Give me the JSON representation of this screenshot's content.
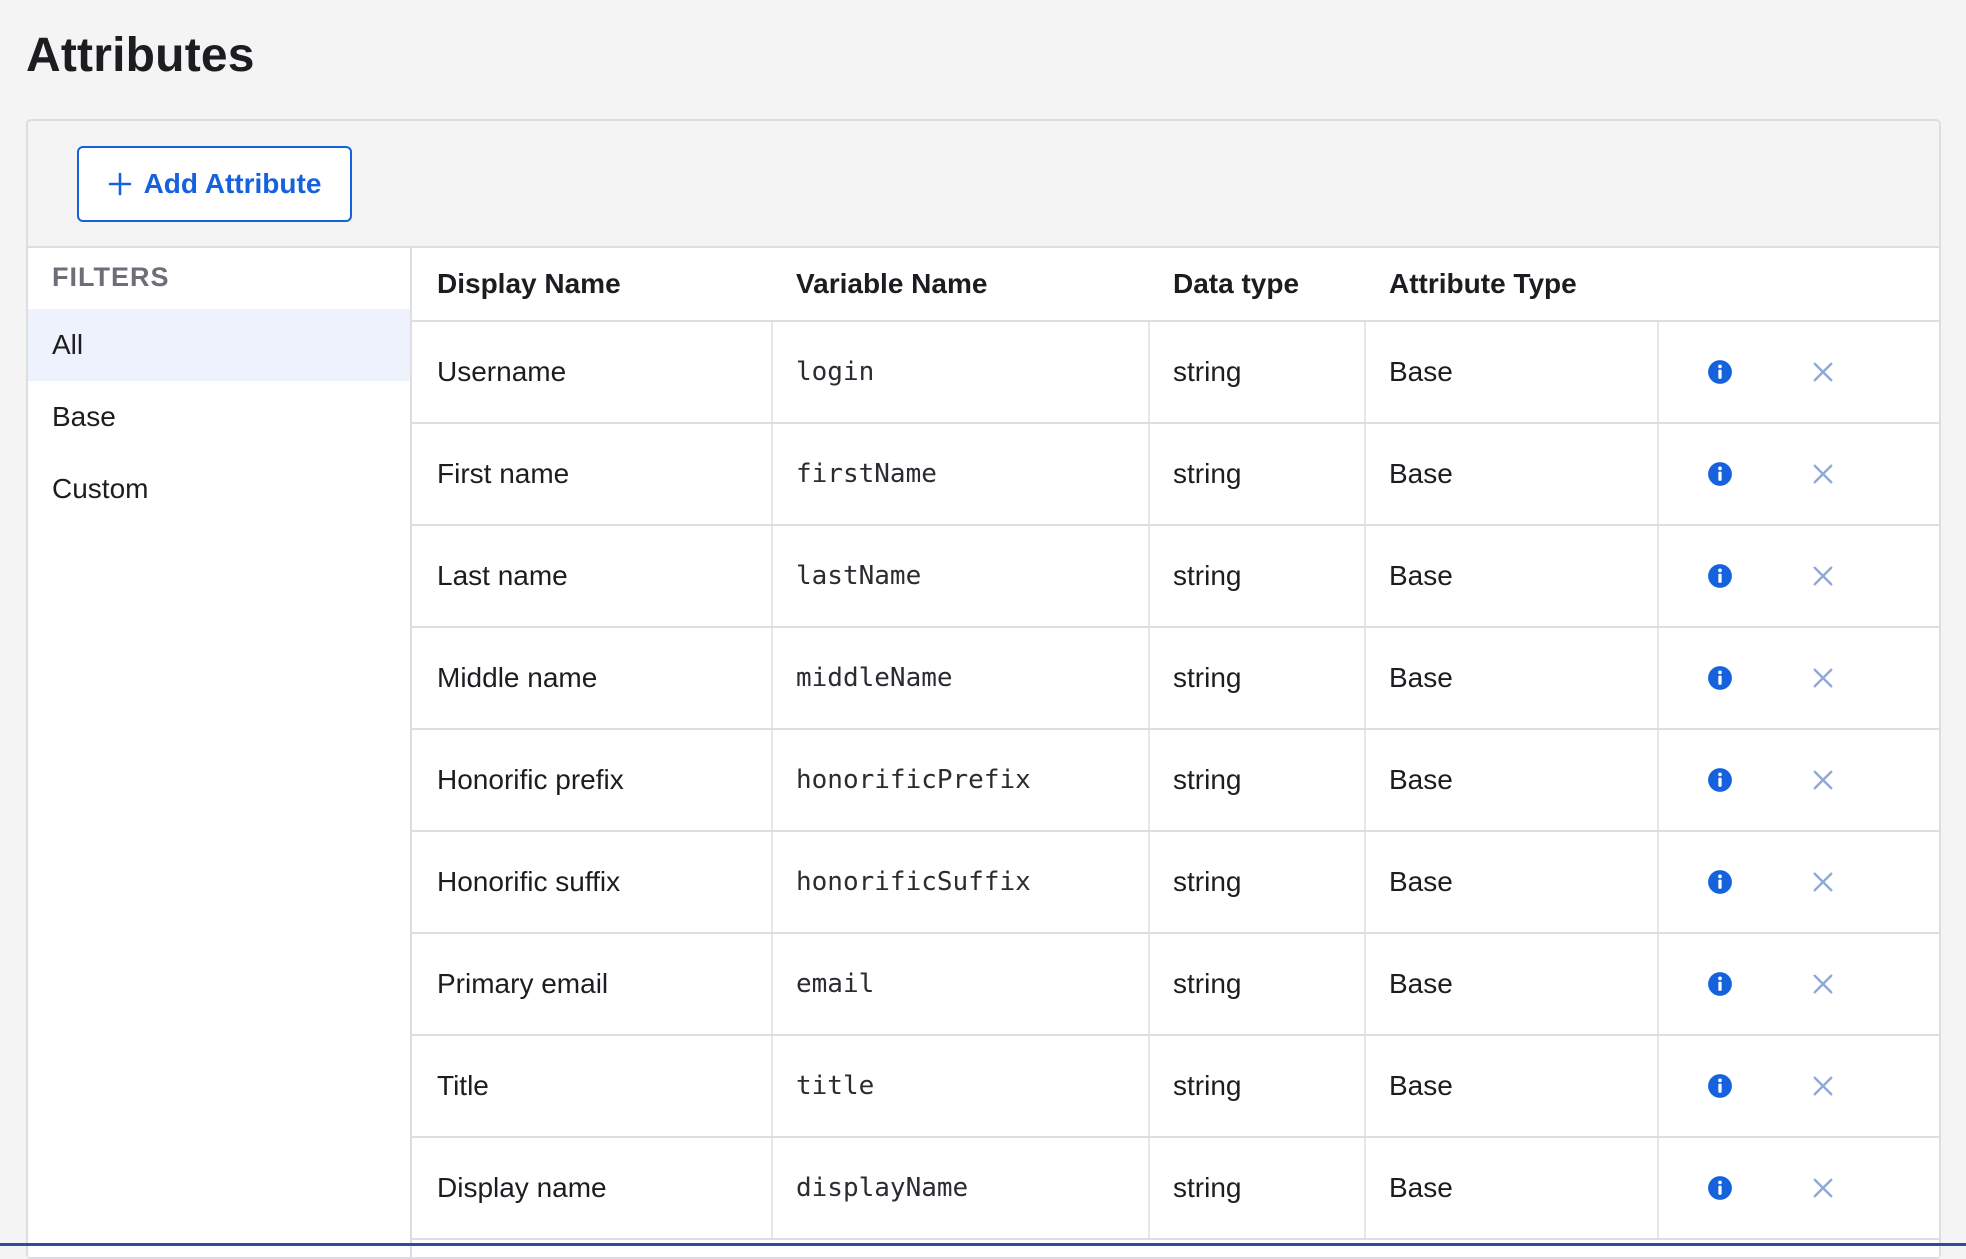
{
  "page": {
    "title": "Attributes"
  },
  "toolbar": {
    "add_label": "Add Attribute"
  },
  "filters": {
    "heading": "FILTERS",
    "items": [
      {
        "label": "All",
        "active": true
      },
      {
        "label": "Base",
        "active": false
      },
      {
        "label": "Custom",
        "active": false
      }
    ]
  },
  "table": {
    "headers": [
      "Display Name",
      "Variable Name",
      "Data type",
      "Attribute Type"
    ],
    "rows": [
      {
        "display": "Username",
        "variable": "login",
        "type": "string",
        "attr": "Base"
      },
      {
        "display": "First name",
        "variable": "firstName",
        "type": "string",
        "attr": "Base"
      },
      {
        "display": "Last name",
        "variable": "lastName",
        "type": "string",
        "attr": "Base"
      },
      {
        "display": "Middle name",
        "variable": "middleName",
        "type": "string",
        "attr": "Base"
      },
      {
        "display": "Honorific prefix",
        "variable": "honorificPrefix",
        "type": "string",
        "attr": "Base"
      },
      {
        "display": "Honorific suffix",
        "variable": "honorificSuffix",
        "type": "string",
        "attr": "Base"
      },
      {
        "display": "Primary email",
        "variable": "email",
        "type": "string",
        "attr": "Base"
      },
      {
        "display": "Title",
        "variable": "title",
        "type": "string",
        "attr": "Base"
      },
      {
        "display": "Display name",
        "variable": "displayName",
        "type": "string",
        "attr": "Base"
      }
    ]
  },
  "colors": {
    "accent": "#1662dd",
    "close": "#8fa8d8",
    "border": "#dedee2"
  },
  "icons": {
    "add": "plus-icon",
    "info": "info-icon",
    "remove": "close-icon"
  }
}
